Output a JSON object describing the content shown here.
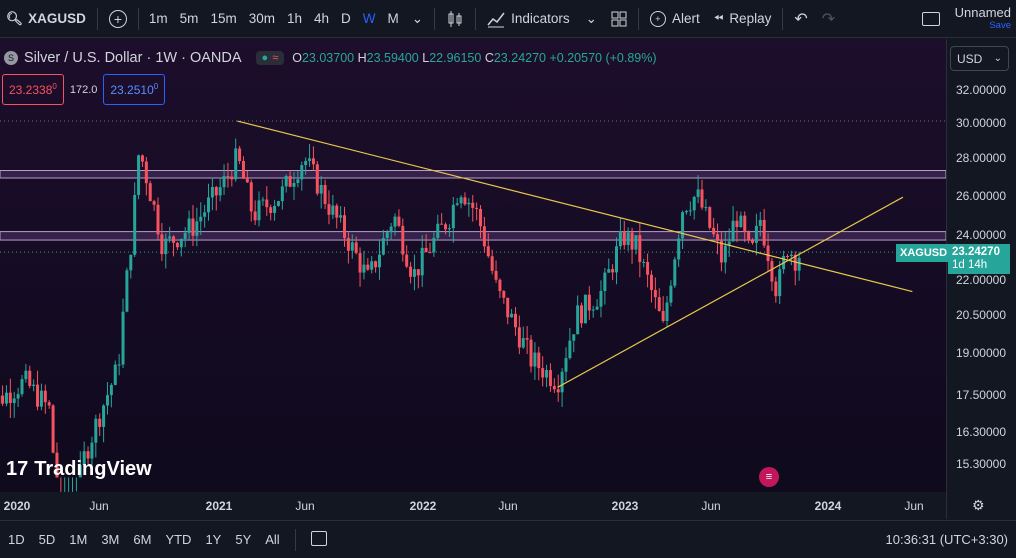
{
  "toolbar": {
    "symbol": "XAGUSD",
    "timeframes": [
      "1m",
      "5m",
      "15m",
      "30m",
      "1h",
      "4h",
      "D",
      "W",
      "M"
    ],
    "active_timeframe": "W",
    "indicators_label": "Indicators",
    "alert_label": "Alert",
    "replay_label": "Replay",
    "layout_name": "Unnamed",
    "save_label": "Save"
  },
  "legend": {
    "title": "Silver / U.S. Dollar · 1W · OANDA",
    "open_label": "O",
    "open": "23.03700",
    "high_label": "H",
    "high": "23.59400",
    "low_label": "L",
    "low": "22.96150",
    "close_label": "C",
    "close": "23.24270",
    "change": "+0.20570 (+0.89%)"
  },
  "trade": {
    "sell_price": "23.2338",
    "sell_sup": "0",
    "spread": "172.0",
    "buy_price": "23.2510",
    "buy_sup": "0"
  },
  "currency_button": "USD",
  "price_axis": [
    "32.00000",
    "30.00000",
    "28.00000",
    "26.00000",
    "24.00000",
    "22.00000",
    "20.50000",
    "19.00000",
    "17.50000",
    "16.30000",
    "15.30000"
  ],
  "price_tag": {
    "symbol": "XAGUSD",
    "price": "23.24270",
    "countdown": "1d 14h"
  },
  "time_axis": [
    "2020",
    "Jun",
    "2021",
    "Jun",
    "2022",
    "Jun",
    "2023",
    "Jun",
    "2024",
    "Jun"
  ],
  "bottom": {
    "ranges": [
      "1D",
      "5D",
      "1M",
      "3M",
      "6M",
      "YTD",
      "1Y",
      "5Y",
      "All"
    ],
    "clock": "10:36:31 (UTC+3:30)"
  },
  "watermark": "TradingView",
  "colors": {
    "up": "#26a69a",
    "down": "#f7525f",
    "accent": "#2962ff",
    "trendline": "#e6c84a",
    "zone": "#c7b0d6"
  },
  "chart_data": {
    "type": "candlestick",
    "symbol": "XAGUSD",
    "interval": "1W",
    "source": "OANDA",
    "ylim": [
      14.8,
      33.0
    ],
    "y_scale": "log",
    "current_price": 23.2427,
    "resistance_zones": [
      [
        26.9,
        27.3
      ],
      [
        23.8,
        24.2
      ]
    ],
    "trendlines": [
      {
        "name": "descending",
        "from": [
          "2021-02-01",
          30.1
        ],
        "to": [
          "2024-06-01",
          21.5
        ]
      },
      {
        "name": "ascending",
        "from": [
          "2022-09-01",
          17.8
        ],
        "to": [
          "2024-05-15",
          25.9
        ]
      }
    ]
  }
}
